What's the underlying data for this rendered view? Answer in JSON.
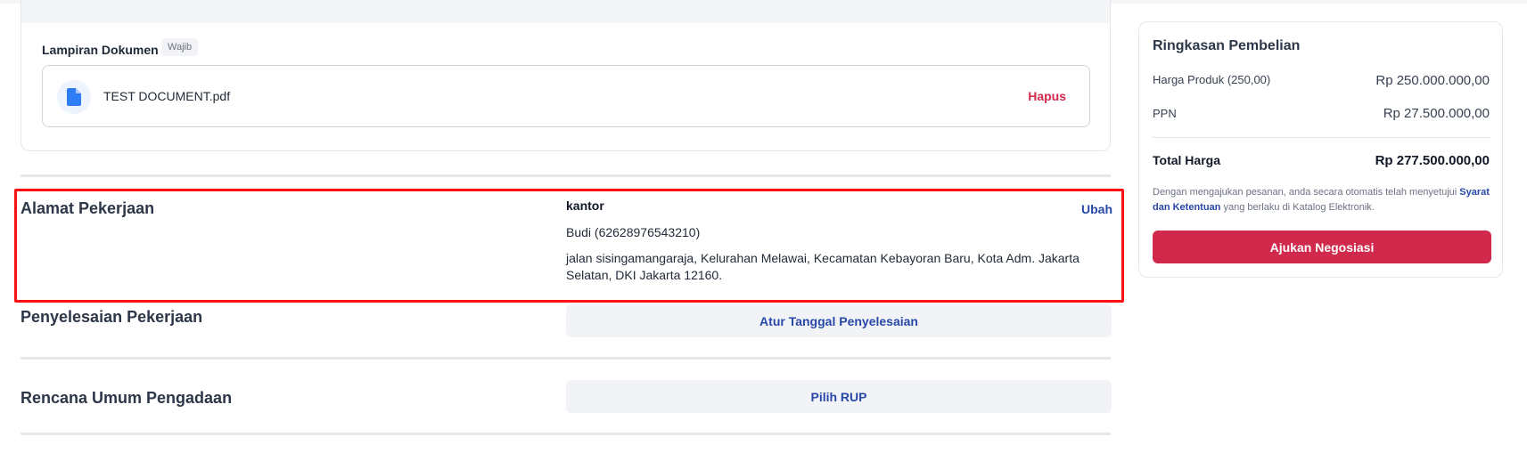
{
  "attachment": {
    "label": "Lampiran Dokumen",
    "badge": "Wajib",
    "file_name": "TEST DOCUMENT.pdf",
    "delete_label": "Hapus",
    "icon": "file-document-icon"
  },
  "work_address": {
    "title": "Alamat Pekerjaan",
    "name": "kantor",
    "person": "Budi (62628976543210)",
    "address": "jalan sisingamangaraja, Kelurahan Melawai, Kecamatan Kebayoran Baru, Kota Adm. Jakarta Selatan, DKI Jakarta 12160.",
    "edit_label": "Ubah"
  },
  "completion": {
    "title": "Penyelesaian Pekerjaan",
    "action_label": "Atur Tanggal Penyelesaian"
  },
  "procurement_plan": {
    "title": "Rencana Umum Pengadaan",
    "action_label": "Pilih RUP"
  },
  "summary": {
    "title": "Ringkasan Pembelian",
    "product_label": "Harga Produk (250,00)",
    "product_value": "Rp 250.000.000,00",
    "tax_label": "PPN",
    "tax_value": "Rp 27.500.000,00",
    "total_label": "Total Harga",
    "total_value": "Rp 277.500.000,00",
    "terms_prefix": "Dengan mengajukan pesanan, anda secara otomatis telah menyetujui",
    "terms_link": "Syarat dan Ketentuan",
    "terms_suffix": "yang berlaku di Katalog Elektronik.",
    "cta_label": "Ajukan Negosiasi"
  },
  "colors": {
    "accent_red": "#d0294b",
    "link_blue": "#2848a8",
    "highlight": "#ff1010"
  }
}
